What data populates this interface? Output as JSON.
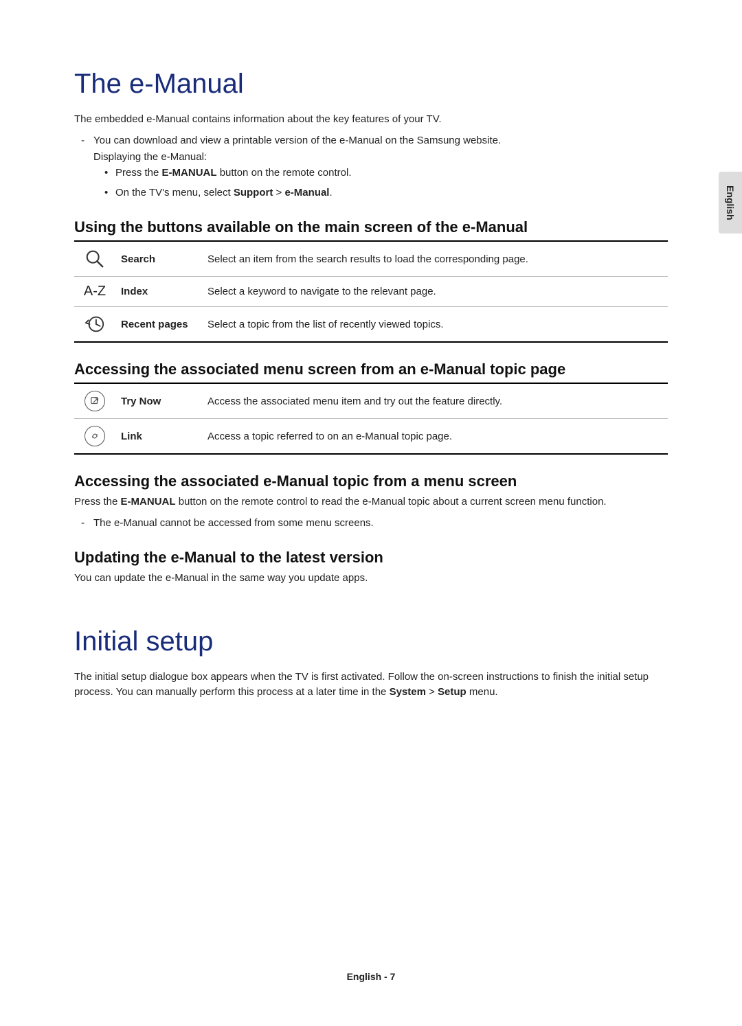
{
  "language_tab": "English",
  "footer": "English - 7",
  "h1_emanual": "The e-Manual",
  "intro": "The embedded e-Manual contains information about the key features of your TV.",
  "dash1_pre": "You can download and view a printable version of the e-Manual on the Samsung website.",
  "dash1_sub": "Displaying the e-Manual:",
  "bullet1_pre": "Press the ",
  "bullet1_bold": "E-MANUAL",
  "bullet1_post": " button on the remote control.",
  "bullet2_pre": "On the TV's menu, select ",
  "bullet2_bold1": "Support",
  "bullet2_gt": " > ",
  "bullet2_bold2": "e-Manual",
  "bullet2_post": ".",
  "h2_buttons": "Using the buttons available on the main screen of the e-Manual",
  "table1": {
    "rows": [
      {
        "icon": "search",
        "label": "Search",
        "desc": "Select an item from the search results to load the corresponding page."
      },
      {
        "icon": "az",
        "label": "Index",
        "desc": "Select a keyword to navigate to the relevant page."
      },
      {
        "icon": "recent",
        "label": "Recent pages",
        "desc": "Select a topic from the list of recently viewed topics."
      }
    ]
  },
  "h2_accessing": "Accessing the associated menu screen from an e-Manual topic page",
  "table2": {
    "rows": [
      {
        "icon": "trynow",
        "label": "Try Now",
        "desc": "Access the associated menu item and try out the feature directly."
      },
      {
        "icon": "link",
        "label": "Link",
        "desc": "Access a topic referred to on an e-Manual topic page."
      }
    ]
  },
  "h2_access_menu": "Accessing the associated e-Manual topic from a menu screen",
  "access_menu_p_pre": "Press the ",
  "access_menu_p_bold": "E-MANUAL",
  "access_menu_p_post": " button on the remote control to read the e-Manual topic about a current screen menu function.",
  "access_menu_dash": "The e-Manual cannot be accessed from some menu screens.",
  "h2_updating": "Updating the e-Manual to the latest version",
  "updating_p": "You can update the e-Manual in the same way you update apps.",
  "h1_initial": "Initial setup",
  "initial_p_pre": "The initial setup dialogue box appears when the TV is first activated. Follow the on-screen instructions to finish the initial setup process. You can manually perform this process at a later time in the ",
  "initial_bold1": "System",
  "initial_gt": " > ",
  "initial_bold2": "Setup",
  "initial_post": " menu.",
  "az_icon_text": "A-Z"
}
